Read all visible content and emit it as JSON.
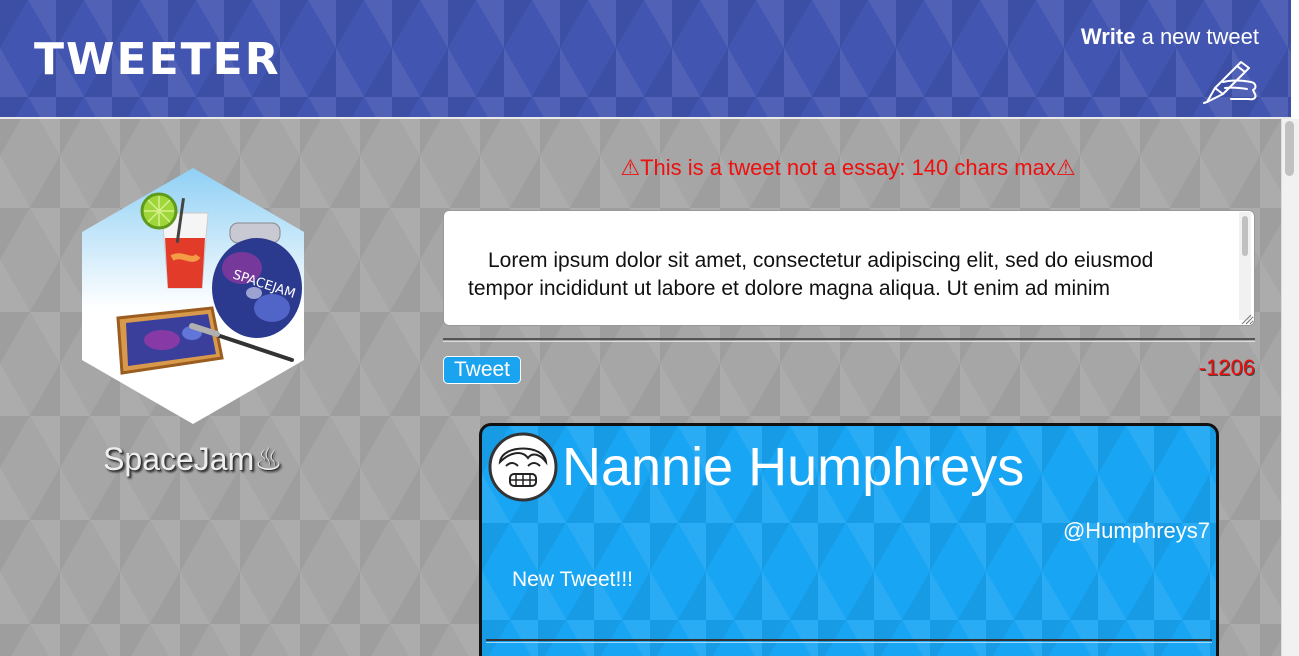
{
  "header": {
    "brand": "TWEETER",
    "compose_bold": "Write",
    "compose_rest": " a new tweet",
    "compose_icon": "pen-hand-icon"
  },
  "profile": {
    "avatar": "space-jam-avatar",
    "display_name": "SpaceJam♨"
  },
  "composer": {
    "warning": "⚠This is a tweet not a essay: 140 chars max⚠",
    "text": "Lorem ipsum dolor sit amet, consectetur adipiscing elit, sed do eiusmod tempor incididunt ut labore et dolore magna aliqua. Ut enim ad minim",
    "submit_label": "Tweet",
    "char_counter": "-1206"
  },
  "tweets": [
    {
      "avatar": "face-avatar",
      "name": "Nannie Humphreys",
      "handle": "@Humphreys7",
      "body": "New Tweet!!!"
    }
  ],
  "colors": {
    "header_bg": "#4255b0",
    "page_bg": "#a6a6a6",
    "warning": "#ee0f0f",
    "tweet_bg": "#18a5f3",
    "button_bg": "#1aa3ef"
  }
}
